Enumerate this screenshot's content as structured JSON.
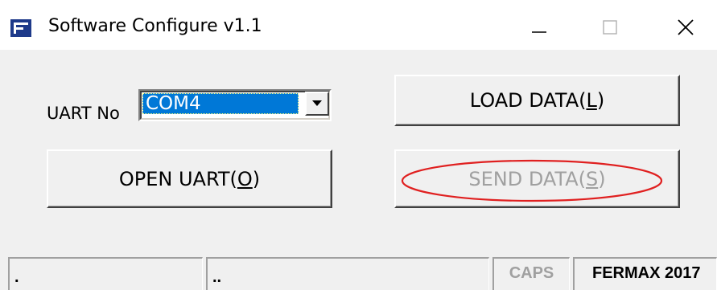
{
  "window": {
    "title": "Software Configure v1.1",
    "icon": "app-f-icon",
    "controls": [
      "minimize-icon",
      "maximize-icon",
      "close-icon"
    ]
  },
  "form": {
    "uart_label": "UART No",
    "uart_selected": "COM4",
    "buttons": {
      "load_prefix": "LOAD DATA(",
      "load_mnemonic": "L",
      "load_suffix": ")",
      "open_prefix": "OPEN UART(",
      "open_mnemonic": "O",
      "open_suffix": ")",
      "send_prefix": "SEND DATA(",
      "send_mnemonic": "S",
      "send_suffix": ")",
      "send_enabled": false
    }
  },
  "statusbar": {
    "panel1": ".",
    "panel2": "..",
    "caps": "CAPS",
    "brand": "FERMAX 2017"
  },
  "annotation": {
    "color": "#e02020",
    "target": "send-data-button"
  },
  "colors": {
    "selection": "#0078d7",
    "disabled_text": "#a0a0a0",
    "face": "#f0f0f0",
    "app_icon": "#1e3a8a"
  }
}
